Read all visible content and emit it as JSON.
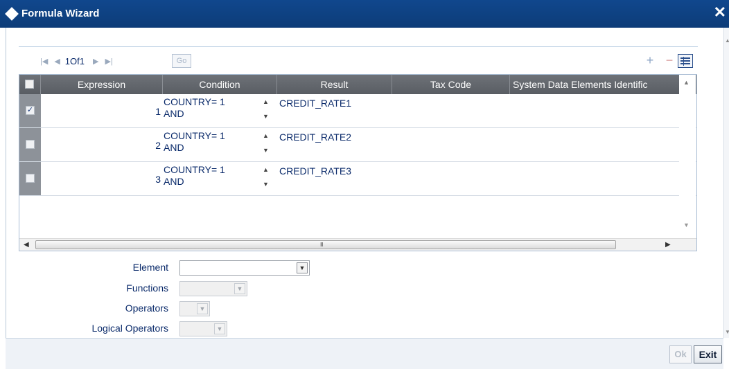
{
  "window": {
    "title": "Formula Wizard",
    "close_label": "✕"
  },
  "pager": {
    "first": "|◀",
    "prev": "◀",
    "pages": "1Of1",
    "next": "▶",
    "last": "▶|",
    "go_label": "Go"
  },
  "toolbar": {
    "add": "+",
    "delete": "−"
  },
  "grid": {
    "columns": [
      "Expression",
      "Condition",
      "Result",
      "Tax Code",
      "System Data Elements Identific"
    ],
    "rows": [
      {
        "checked": true,
        "expression": "1",
        "condition_line1": "COUNTRY= 1",
        "condition_line2": "AND",
        "result": "CREDIT_RATE1",
        "tax_code": "",
        "sde": ""
      },
      {
        "checked": false,
        "expression": "2",
        "condition_line1": "COUNTRY= 1",
        "condition_line2": "AND",
        "result": "CREDIT_RATE2",
        "tax_code": "",
        "sde": ""
      },
      {
        "checked": false,
        "expression": "3",
        "condition_line1": "COUNTRY= 1",
        "condition_line2": "AND",
        "result": "CREDIT_RATE3",
        "tax_code": "",
        "sde": ""
      }
    ],
    "check_mark": "✓",
    "hscroll_grip": "III"
  },
  "form": {
    "element_label": "Element",
    "element_value": "",
    "functions_label": "Functions",
    "functions_value": "",
    "operators_label": "Operators",
    "operators_value": "",
    "logical_operators_label": "Logical Operators",
    "logical_operators_value": ""
  },
  "footer": {
    "ok_label": "Ok",
    "exit_label": "Exit"
  },
  "colors": {
    "titlebar": "#10478d",
    "header": "#5f6369",
    "text": "#0a2a6a"
  }
}
